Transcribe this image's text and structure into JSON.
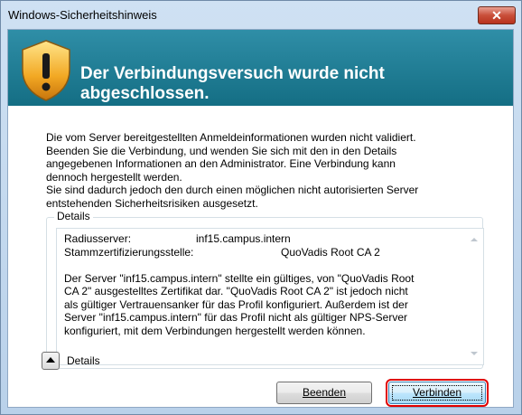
{
  "window": {
    "title": "Windows-Sicherheitshinweis",
    "close_glyph": "✕"
  },
  "banner": {
    "heading": "Der Verbindungsversuch wurde nicht abgeschlossen."
  },
  "main_text": [
    "Die vom Server bereitgestellten Anmeldeinformationen wurden nicht validiert.",
    "Beenden Sie die Verbindung, und wenden Sie sich mit den in den Details",
    "angegebenen Informationen an den Administrator. Eine Verbindung kann",
    "dennoch hergestellt werden.",
    "Sie sind dadurch jedoch den durch einen möglichen nicht autorisierten Server",
    "entstehenden Sicherheitsrisiken ausgesetzt."
  ],
  "details": {
    "group_label": "Details",
    "radius_label": "Radiusserver:",
    "radius_value": "inf15.campus.intern",
    "root_label": "Stammzertifizierungsstelle:",
    "root_value": "QuoVadis Root CA 2",
    "description": [
      "Der Server \"inf15.campus.intern\" stellte ein gültiges, von \"QuoVadis Root",
      "CA 2\" ausgestelltes Zertifikat dar. \"QuoVadis Root CA 2\" ist jedoch nicht",
      "als gültiger Vertrauensanker für das Profil konfiguriert. Außerdem ist der",
      "Server \"inf15.campus.intern\" für das Profil nicht als gültiger NPS-Server",
      "konfiguriert, mit dem Verbindungen hergestellt werden können."
    ]
  },
  "footer": {
    "toggle_label": "Details",
    "quit_label": "Beenden",
    "connect_label": "Verbinden"
  },
  "colors": {
    "banner": "#1d7d95",
    "highlight_border": "#e00000"
  }
}
